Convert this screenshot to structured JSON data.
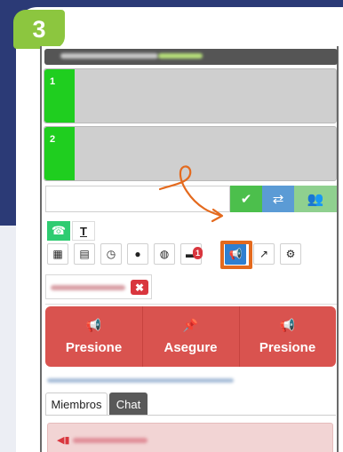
{
  "step": {
    "number": "3"
  },
  "lines": [
    {
      "number": "1"
    },
    {
      "number": "2"
    }
  ],
  "dial": {
    "placeholder": ""
  },
  "dial_buttons": [
    {
      "icon": "check-icon",
      "glyph": "✔",
      "color": "#4cbf4c"
    },
    {
      "icon": "transfer-icon",
      "glyph": "⇄",
      "color": "#5b9bd5"
    },
    {
      "icon": "group-icon",
      "glyph": "👥",
      "color": "#8fd08f"
    }
  ],
  "modes": [
    {
      "icon": "phone-icon",
      "glyph": "☎"
    },
    {
      "icon": "text-icon",
      "glyph": "T"
    }
  ],
  "toolbar": [
    {
      "icon": "grid-icon",
      "glyph": "▦"
    },
    {
      "icon": "list-icon",
      "glyph": "▤"
    },
    {
      "icon": "clock-icon",
      "glyph": "◷"
    },
    {
      "icon": "user-icon",
      "glyph": "●"
    },
    {
      "icon": "globe-icon",
      "glyph": "◍"
    },
    {
      "icon": "chat-icon",
      "glyph": "▬",
      "badge": "1"
    },
    {
      "icon": "megaphone-icon",
      "glyph": "📢",
      "active": true
    },
    {
      "icon": "share-icon",
      "glyph": "↗"
    },
    {
      "icon": "gear-icon",
      "glyph": "⚙"
    }
  ],
  "chip": {
    "close_glyph": "✖"
  },
  "actions": [
    {
      "label": "Presione",
      "icon": "megaphone-icon",
      "glyph": "📢"
    },
    {
      "label": "Asegure",
      "icon": "pin-icon",
      "glyph": "📌"
    },
    {
      "label": "Presione",
      "icon": "megaphone-icon",
      "glyph": "📢"
    }
  ],
  "tabs": [
    {
      "label": "Miembros",
      "active": true
    },
    {
      "label": "Chat",
      "active": false
    }
  ],
  "colors": {
    "accent_orange": "#e46a1e",
    "danger": "#d9534f",
    "line_green": "#1fce1f",
    "badge_green": "#8cc63f",
    "navy": "#2b3a76"
  }
}
